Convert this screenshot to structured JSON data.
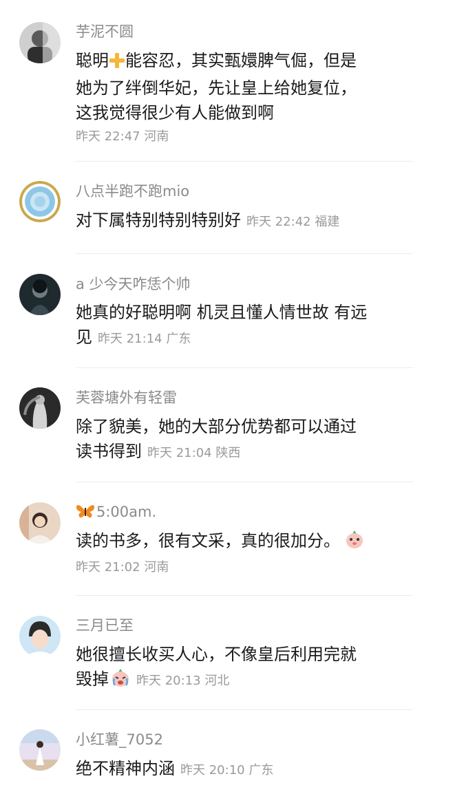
{
  "comments": [
    {
      "username": "芋泥不圆",
      "lines": [
        "聪明",
        "能容忍，其实甄嬛脾气倔，但是",
        "她为了绊倒华妃，先让皇上给她复位，",
        "这我觉得很少有人能做到啊"
      ],
      "time": "昨天 22:47",
      "location": "河南",
      "emoji": "plus-emoji"
    },
    {
      "username": "八点半跑不跑mio",
      "lines": [
        "对下属特别特别特别好"
      ],
      "time": "昨天 22:42",
      "location": "福建"
    },
    {
      "username": "a 少今天咋恁个帅",
      "lines": [
        "她真的好聪明啊 机灵且懂人情世故 有远",
        "见"
      ],
      "time": "昨天 21:14",
      "location": "广东"
    },
    {
      "username": "芙蓉塘外有轻雷",
      "lines": [
        "除了貌美，她的大部分优势都可以通过",
        "读书得到"
      ],
      "time": "昨天 21:04",
      "location": "陕西"
    },
    {
      "username": "5:00am.",
      "username_icon": "butterfly-icon",
      "lines": [
        "读的书多，很有文采，真的很加分。"
      ],
      "time": "昨天 21:02",
      "location": "河南",
      "emoji": "peach-face-emoji"
    },
    {
      "username": "三月已至",
      "lines": [
        "她很擅长收买人心，不像皇后利用完就",
        "毁掉"
      ],
      "time": "昨天 20:13",
      "location": "河北",
      "emoji": "crying-face-emoji"
    },
    {
      "username": "小红薯_7052",
      "lines": [
        "绝不精神内涵"
      ],
      "time": "昨天 20:10",
      "location": "广东"
    }
  ]
}
